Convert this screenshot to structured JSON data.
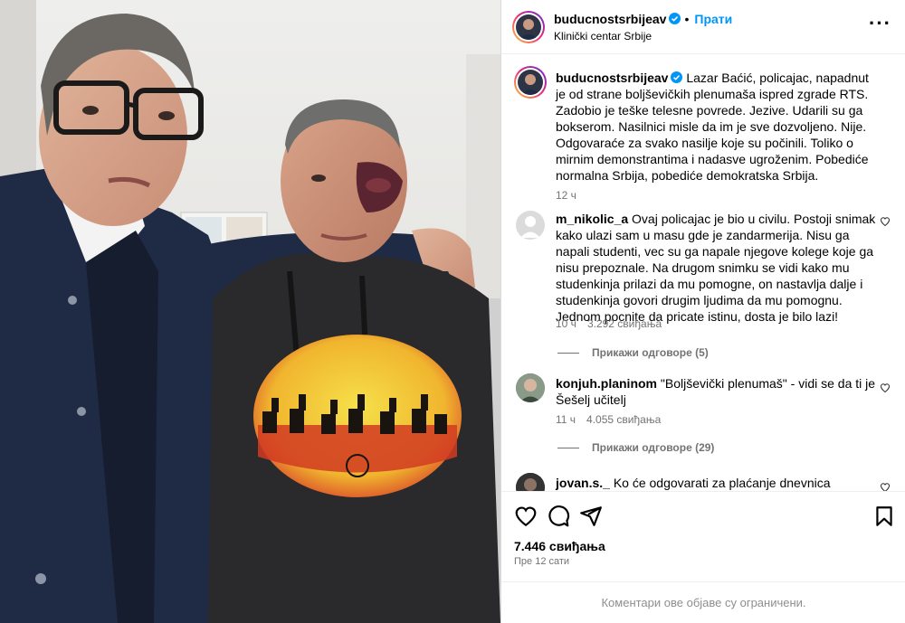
{
  "header": {
    "username": "buducnostsrbijeav",
    "follow_label": "Прати",
    "location": "Klinički centar Srbije",
    "more_icon": "more-horizontal-icon"
  },
  "caption": {
    "username": "buducnostsrbijeav",
    "text": "Lazar Baćić, policajac, napadnut je od strane boljševičkih plenumaša ispred zgrade RTS. Zadobio je teške telesne povrede. Jezive. Udarili su ga bokserom. Nasilnici misle da im je sve dozvoljeno. Nije. Odgovaraće za svako nasilje koje su počinili. Toliko o mirnim demonstrantima i nadasve ugroženim. Pobediće normalna Srbija, pobediće demokratska Srbija.",
    "time": "12 ч"
  },
  "comments": [
    {
      "username": "m_nikolic_a",
      "text": "Ovaj policajac je bio u civilu. Postoji snimak kako ulazi sam u masu gde je zandarmerija. Nisu ga napali studenti, vec su ga napale njegove kolege koje ga nisu prepoznale. Na drugom snimku se vidi kako mu studenkinja prilazi da mu pomogne, on nastavlja dalje i studenkinja govori drugim ljudima da mu pomognu. Jednom pocnite da pricate istinu, dosta je bilo lazi!",
      "time": "10 ч",
      "likes": "3.292 свиђања",
      "replies": "Прикажи одговоре (5)"
    },
    {
      "username": "konjuh.planinom",
      "text": "\"Boljševički plenumaš\" - vidi se da ti je Šešelj učitelj",
      "time": "11 ч",
      "likes": "4.055 свиђања",
      "replies": "Прикажи одговоре (29)"
    },
    {
      "username": "jovan.s._",
      "text": "Ko će odgovarati za plaćanje dnevnica Ćacijima koji"
    }
  ],
  "actions": {
    "like_icon": "heart-icon",
    "comment_icon": "comment-icon",
    "share_icon": "share-icon",
    "save_icon": "bookmark-icon",
    "likes_total": "7.446 свиђања",
    "posted_ago": "Пре 12 сати"
  },
  "footer": {
    "comments_limited": "Коментари ове објаве су ограничени."
  },
  "colors": {
    "accent": "#0095f6",
    "muted": "#737373",
    "border": "#dbdbdb"
  }
}
